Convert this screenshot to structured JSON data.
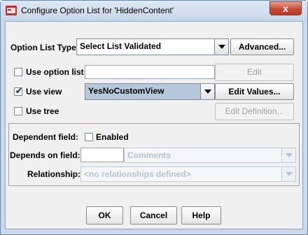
{
  "window": {
    "title": "Configure Option List for 'HiddenContent'",
    "close_glyph": "x"
  },
  "option_list_type": {
    "label": "Option List Type:",
    "value": "Select List Validated",
    "advanced_button": "Advanced..."
  },
  "use_option_list": {
    "label": "Use option list",
    "checked": false,
    "input_value": "",
    "edit_button": "Edit"
  },
  "use_view": {
    "label": "Use view",
    "checked": true,
    "value": "YesNoCustomView",
    "edit_values_button": "Edit Values..."
  },
  "use_tree": {
    "label": "Use tree",
    "checked": false,
    "edit_definition_button": "Edit Definition..."
  },
  "dependent": {
    "dependent_field_label": "Dependent field:",
    "enabled_label": "Enabled",
    "enabled_checked": false,
    "depends_on_label": "Depends on field:",
    "depends_on_input": "",
    "depends_on_value": "Comments",
    "relationship_label": "Relationship:",
    "relationship_value": "<no relationships defined>"
  },
  "buttons": {
    "ok": "OK",
    "cancel": "Cancel",
    "help": "Help"
  },
  "icons": {
    "app": "app-icon",
    "dropdown": "chevron-down-icon",
    "check": "checkmark-icon"
  },
  "colors": {
    "title_bar": "#c9d8ea",
    "close_button": "#c84a34",
    "selected_combo": "#b8c8dc"
  }
}
